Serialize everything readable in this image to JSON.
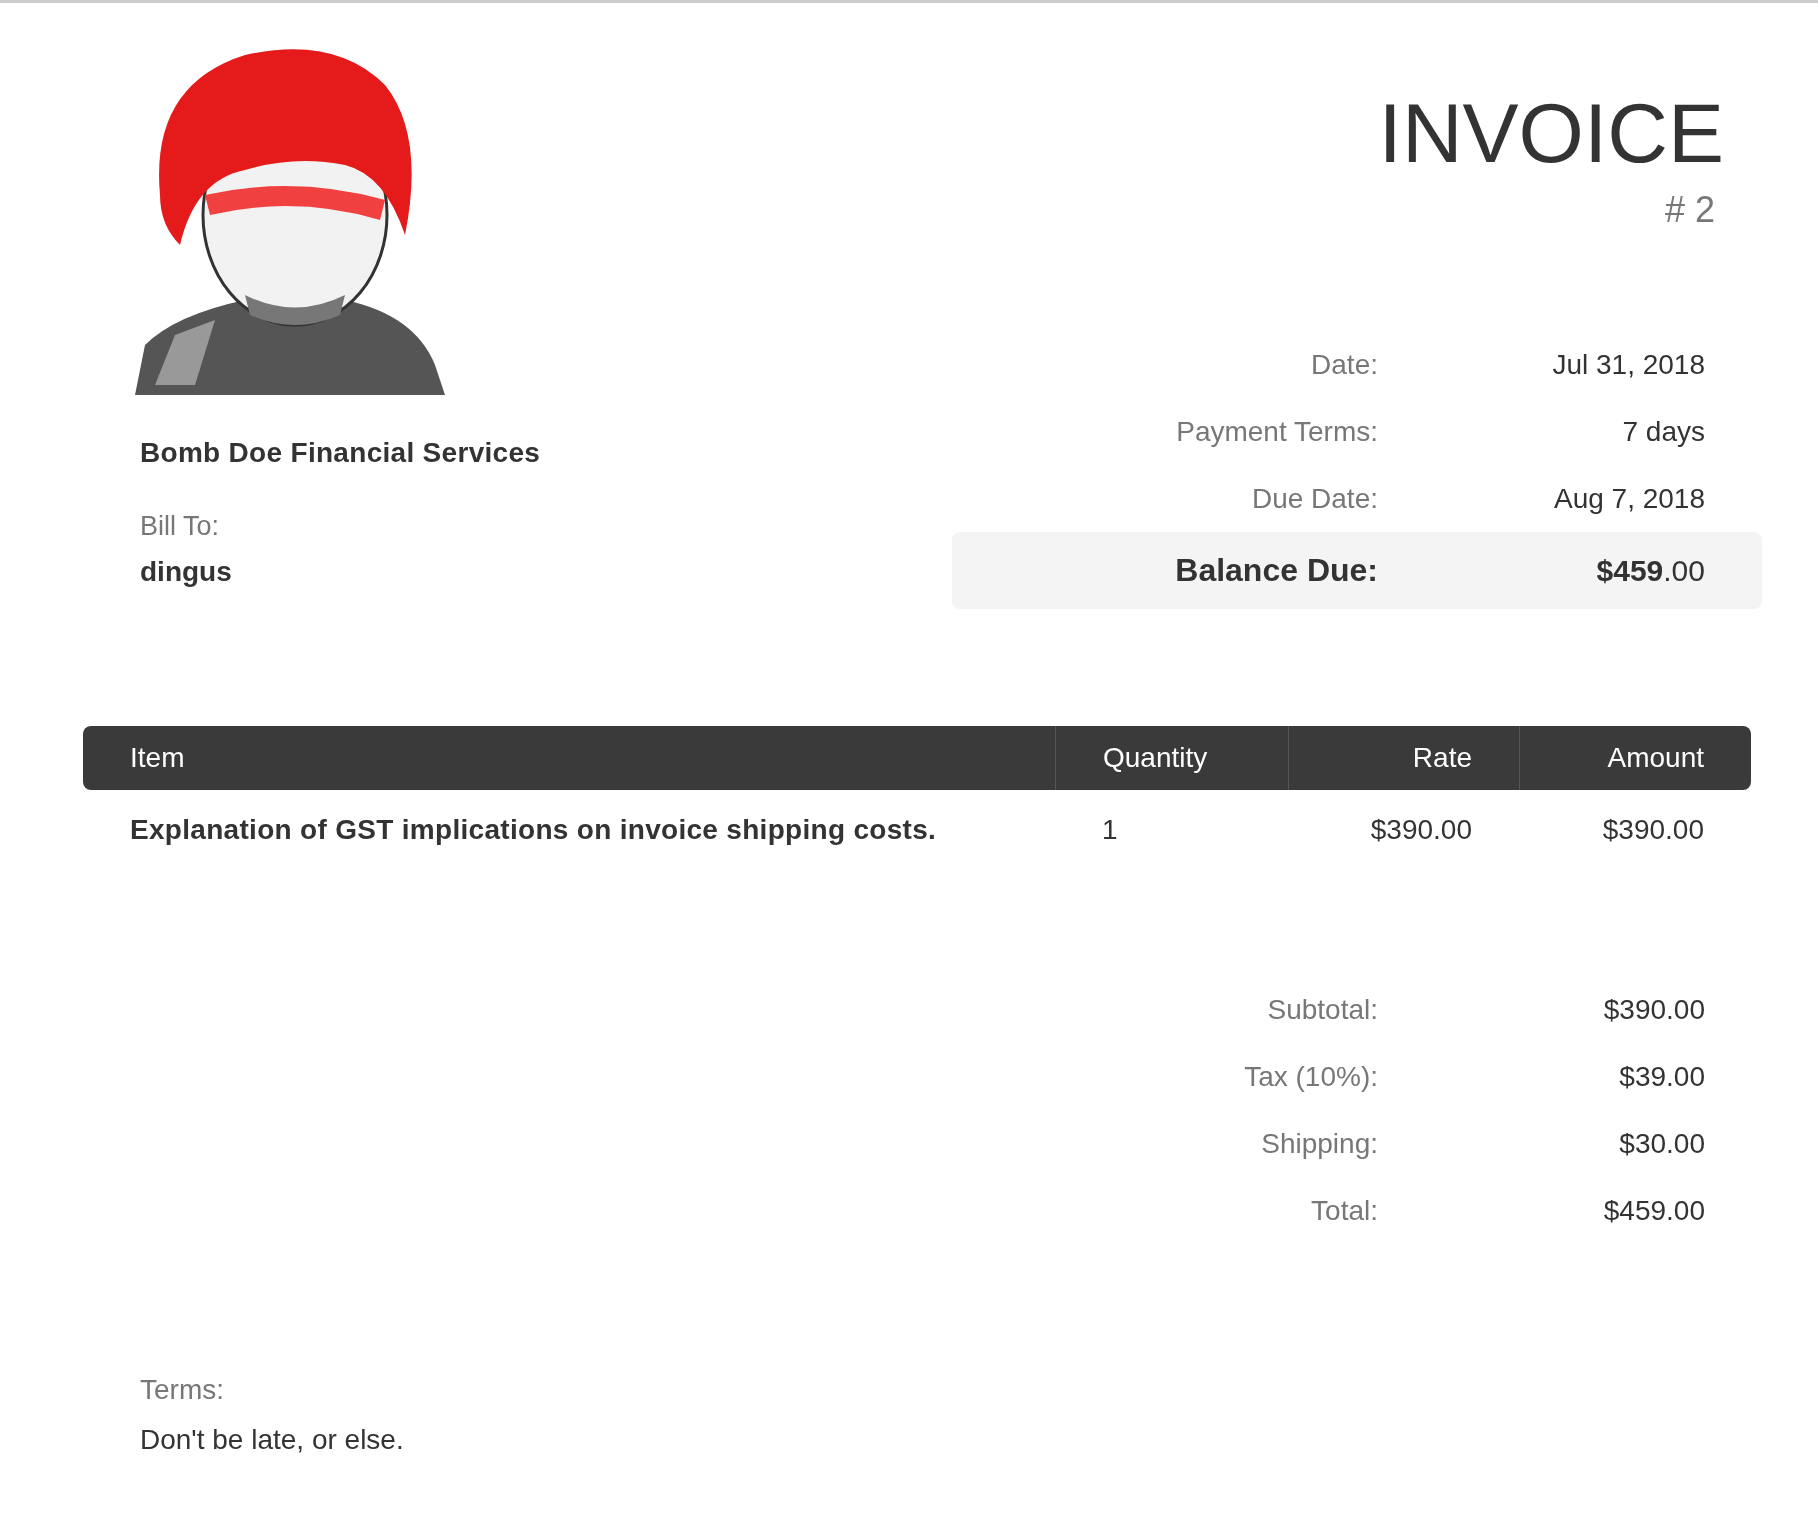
{
  "company": "Bomb Doe Financial Services",
  "bill_to": {
    "label": "Bill To:",
    "name": "dingus"
  },
  "title": "INVOICE",
  "number": "# 2",
  "meta": [
    {
      "label": "Date:",
      "value": "Jul 31, 2018"
    },
    {
      "label": "Payment Terms:",
      "value": "7 days"
    },
    {
      "label": "Due Date:",
      "value": "Aug 7, 2018"
    }
  ],
  "balance_due": {
    "label": "Balance Due:",
    "value": "**$459**.00"
  },
  "table": {
    "columns": [
      "Item",
      "Quantity",
      "Rate",
      "Amount"
    ],
    "rows": [
      {
        "item": "Explanation of GST implications on invoice shipping costs.",
        "quantity": "1",
        "rate": "$390.00",
        "amount": "$390.00"
      }
    ]
  },
  "totals": [
    {
      "label": "Subtotal:",
      "value": "$390.00"
    },
    {
      "label": "Tax (10%):",
      "value": "$39.00"
    },
    {
      "label": "Shipping:",
      "value": "$30.00"
    },
    {
      "label": "Total:",
      "value": "$459.00"
    }
  ],
  "terms": {
    "label": "Terms:",
    "text": "Don't be late, or else."
  }
}
